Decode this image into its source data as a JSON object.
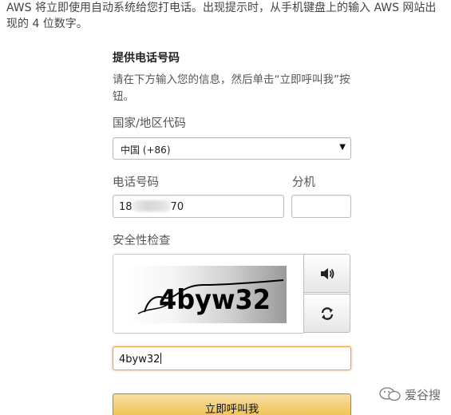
{
  "intro_text": "AWS 将立即使用自动系统给您打电话。出现提示时，从手机键盘上的输入 AWS 网站出现的 4 位数字。",
  "panel": {
    "title": "提供电话号码",
    "description": "请在下方输入您的信息，然后单击“立即呼叫我”按钮。"
  },
  "country": {
    "label": "国家/地区代码",
    "selected": "中国 (+86)"
  },
  "phone": {
    "label": "电话号码",
    "value_prefix": "18",
    "value_suffix": "70",
    "extension_label": "分机",
    "extension_value": ""
  },
  "security": {
    "label": "安全性检查",
    "captcha_text": "4byw32",
    "answer_value": "4byw32"
  },
  "submit_label": "立即呼叫我",
  "watermark_text": "爱谷搜",
  "icons": {
    "audio": "speaker-icon",
    "refresh": "refresh-icon",
    "watermark": "wechat-icon",
    "dropdown": "dropdown-arrow-icon"
  }
}
